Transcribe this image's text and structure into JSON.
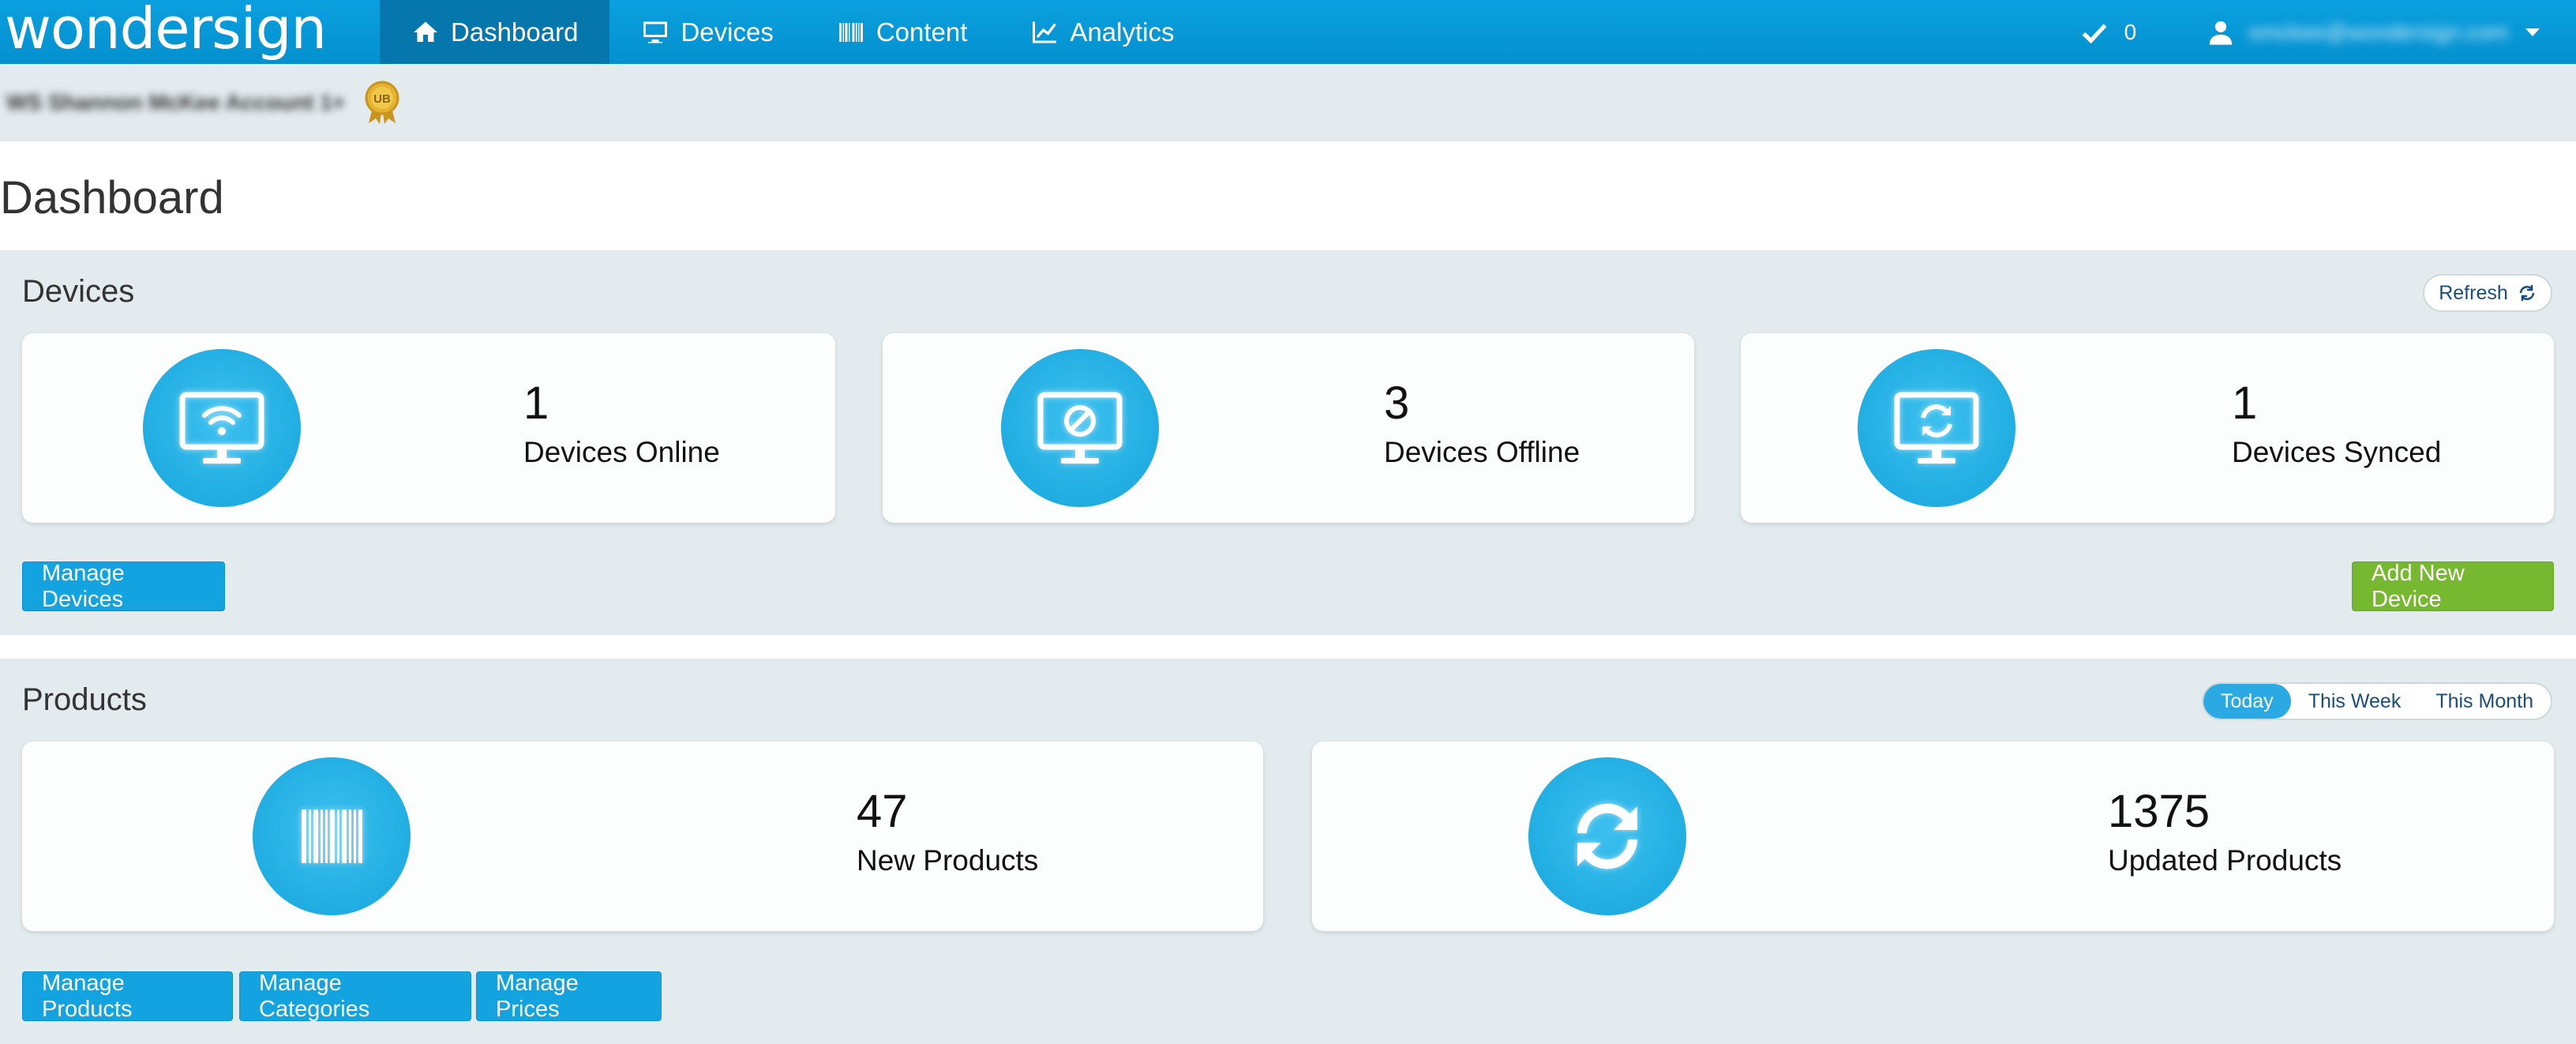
{
  "brand": "wondersign",
  "nav": {
    "tabs": [
      {
        "label": "Dashboard",
        "icon": "home-icon",
        "active": true
      },
      {
        "label": "Devices",
        "icon": "monitor-icon",
        "active": false
      },
      {
        "label": "Content",
        "icon": "barcode-icon",
        "active": false
      },
      {
        "label": "Analytics",
        "icon": "line-chart-icon",
        "active": false
      }
    ],
    "notifications_count": "0",
    "user_email": "smckee@wondersign.com"
  },
  "account": {
    "name": "WS Shannon McKee Account 1+",
    "badge_text": "UB"
  },
  "page_title": "Dashboard",
  "devices_panel": {
    "title": "Devices",
    "refresh_label": "Refresh",
    "cards": [
      {
        "value": "1",
        "label": "Devices Online",
        "icon": "monitor-wifi-icon"
      },
      {
        "value": "3",
        "label": "Devices Offline",
        "icon": "monitor-blocked-icon"
      },
      {
        "value": "1",
        "label": "Devices Synced",
        "icon": "monitor-sync-icon"
      }
    ],
    "manage_label": "Manage Devices",
    "add_label": "Add New Device"
  },
  "products_panel": {
    "title": "Products",
    "periods": [
      {
        "label": "Today",
        "active": true
      },
      {
        "label": "This Week",
        "active": false
      },
      {
        "label": "This Month",
        "active": false
      }
    ],
    "cards": [
      {
        "value": "47",
        "label": "New Products",
        "icon": "barcode-icon"
      },
      {
        "value": "1375",
        "label": "Updated Products",
        "icon": "sync-icon"
      }
    ],
    "buttons": [
      "Manage Products",
      "Manage Categories",
      "Manage Prices"
    ]
  },
  "colors": {
    "nav_bg": "#0590cf",
    "nav_active": "#0677ad",
    "accent_blue": "#12a3e0",
    "accent_green": "#76b82f",
    "panel_bg": "#e3ebef"
  }
}
